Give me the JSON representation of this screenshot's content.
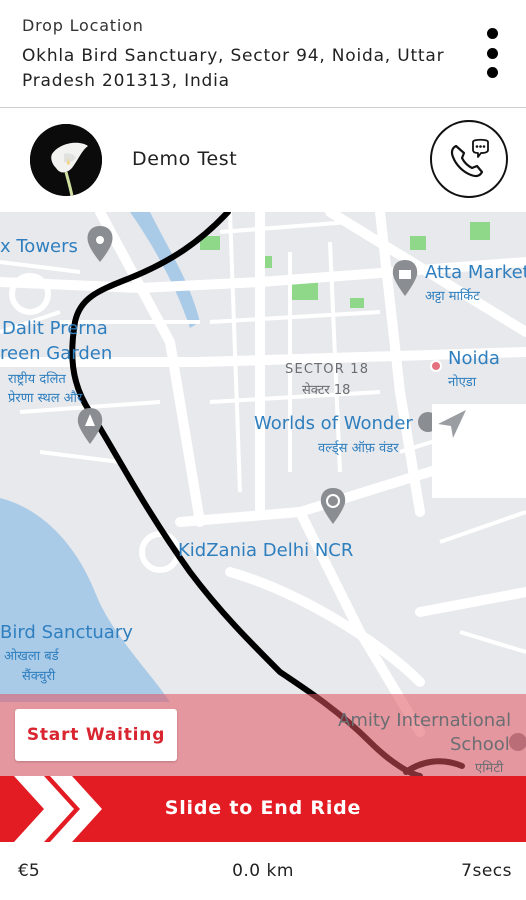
{
  "header": {
    "drop_label": "Drop Location",
    "drop_address": "Okhla Bird Sanctuary, Sector 94, Noida, Uttar Pradesh 201313, India",
    "menu_icon": "more-vertical-icon"
  },
  "rider": {
    "name": "Demo Test",
    "avatar_icon": "calla-lily-photo",
    "call_icon": "phone-chat-icon"
  },
  "map": {
    "labels": {
      "towers": "x Towers",
      "atta_market": "Atta Market",
      "atta_market_hi": "अट्टा मार्किट",
      "dalit_prerna_1": "Dalit Prerna",
      "dalit_prerna_2": "reen Garden",
      "dalit_prerna_hi_1": "राष्ट्रीय दलित",
      "dalit_prerna_hi_2": "प्रेरणा स्थल और",
      "sector18": "SECTOR 18",
      "sector18_hi": "सेक्टर 18",
      "noida": "Noida",
      "noida_hi": "नोएडा",
      "worlds_of_wonder": "Worlds of Wonder",
      "worlds_of_wonder_hi": "वर्ल्ड्स ऑफ़ वंडर",
      "kidzania": "KidZania Delhi NCR",
      "bird_sanctuary": "Bird Sanctuary",
      "bird_sanctuary_hi_1": "ओखला बर्ड",
      "bird_sanctuary_hi_2": "सैंक्चुरी",
      "amity_1": "Amity International",
      "amity_2": "School",
      "amity_hi": "एमिटी"
    },
    "recenter_icon": "navigation-arrow-icon",
    "route_color": "#000000",
    "water_color": "#aacbe8",
    "park_color": "#8fd88a"
  },
  "actions": {
    "start_waiting": "Start Waiting",
    "slide_to_end": "Slide to End Ride",
    "slider_icon": "double-chevron-right-icon",
    "accent_color": "#e31b23"
  },
  "footer": {
    "fare": "€5",
    "distance": "0.0 km",
    "duration": "7secs"
  }
}
